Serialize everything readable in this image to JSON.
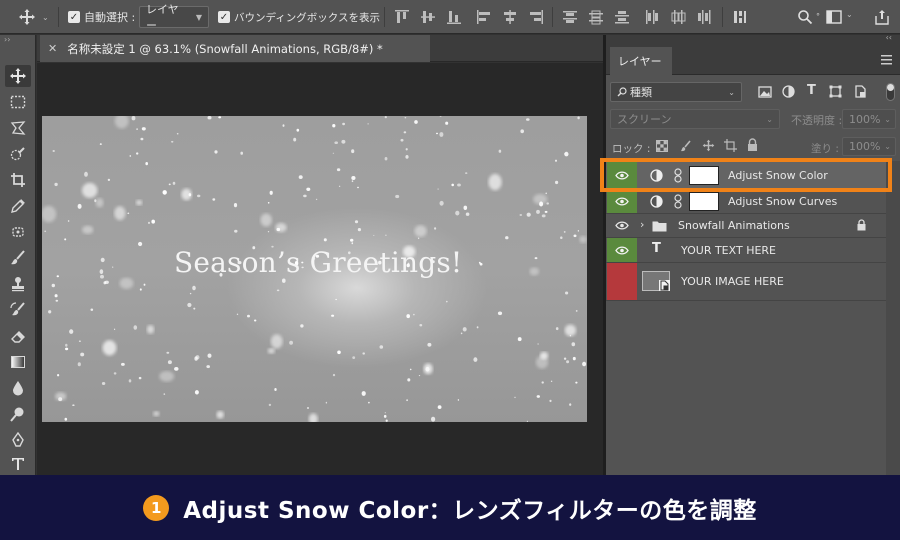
{
  "options_bar": {
    "auto_select_label": "自動選択 :",
    "auto_select_value": "レイヤー",
    "bounding_box_label": "バウンディングボックスを表示"
  },
  "document": {
    "tab_title": "名称未設定 1 @ 63.1% (Snowfall Animations, RGB/8#) *",
    "canvas_text": "Season’s Greetings!"
  },
  "layers_panel": {
    "tab_label": "レイヤー",
    "filter_label": "種類",
    "blend_mode": "スクリーン",
    "opacity_label": "不透明度 :",
    "opacity_value": "100%",
    "lock_label": "ロック :",
    "fill_label": "塗り :",
    "fill_value": "100%",
    "layers": [
      {
        "name": "Adjust Snow Color",
        "eye": "green"
      },
      {
        "name": "Adjust Snow Curves",
        "eye": "green"
      },
      {
        "name": "Snowfall Animations",
        "eye": "gray"
      },
      {
        "name": "YOUR TEXT HERE",
        "eye": "green"
      },
      {
        "name": "YOUR IMAGE HERE",
        "eye": "red"
      }
    ]
  },
  "banner": {
    "badge": "1",
    "text": "Adjust Snow Color：レンズフィルターの色を調整"
  },
  "colors": {
    "highlight": "#f08218",
    "banner_bg": "#131340",
    "eye_green": "#5a8a3d",
    "eye_red": "#b5393c"
  }
}
